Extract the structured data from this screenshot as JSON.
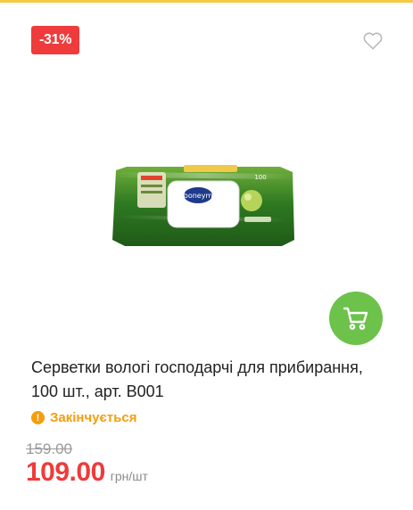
{
  "product": {
    "discount_badge": "-31%",
    "title": "Серветки вологі господарчі для прибирання, 100 шт., арт. B001",
    "stock_status": "Закінчується",
    "old_price": "159.00",
    "price": "109.00",
    "unit": "грн/шт",
    "image_label": "boneym"
  },
  "icons": {
    "favorite": "heart-icon",
    "cart": "cart-icon",
    "stock": "warning-icon"
  },
  "colors": {
    "discount": "#ef3b3b",
    "cart_button": "#6cc24a",
    "stock_status": "#f59e0b",
    "price": "#ef3b3b"
  }
}
